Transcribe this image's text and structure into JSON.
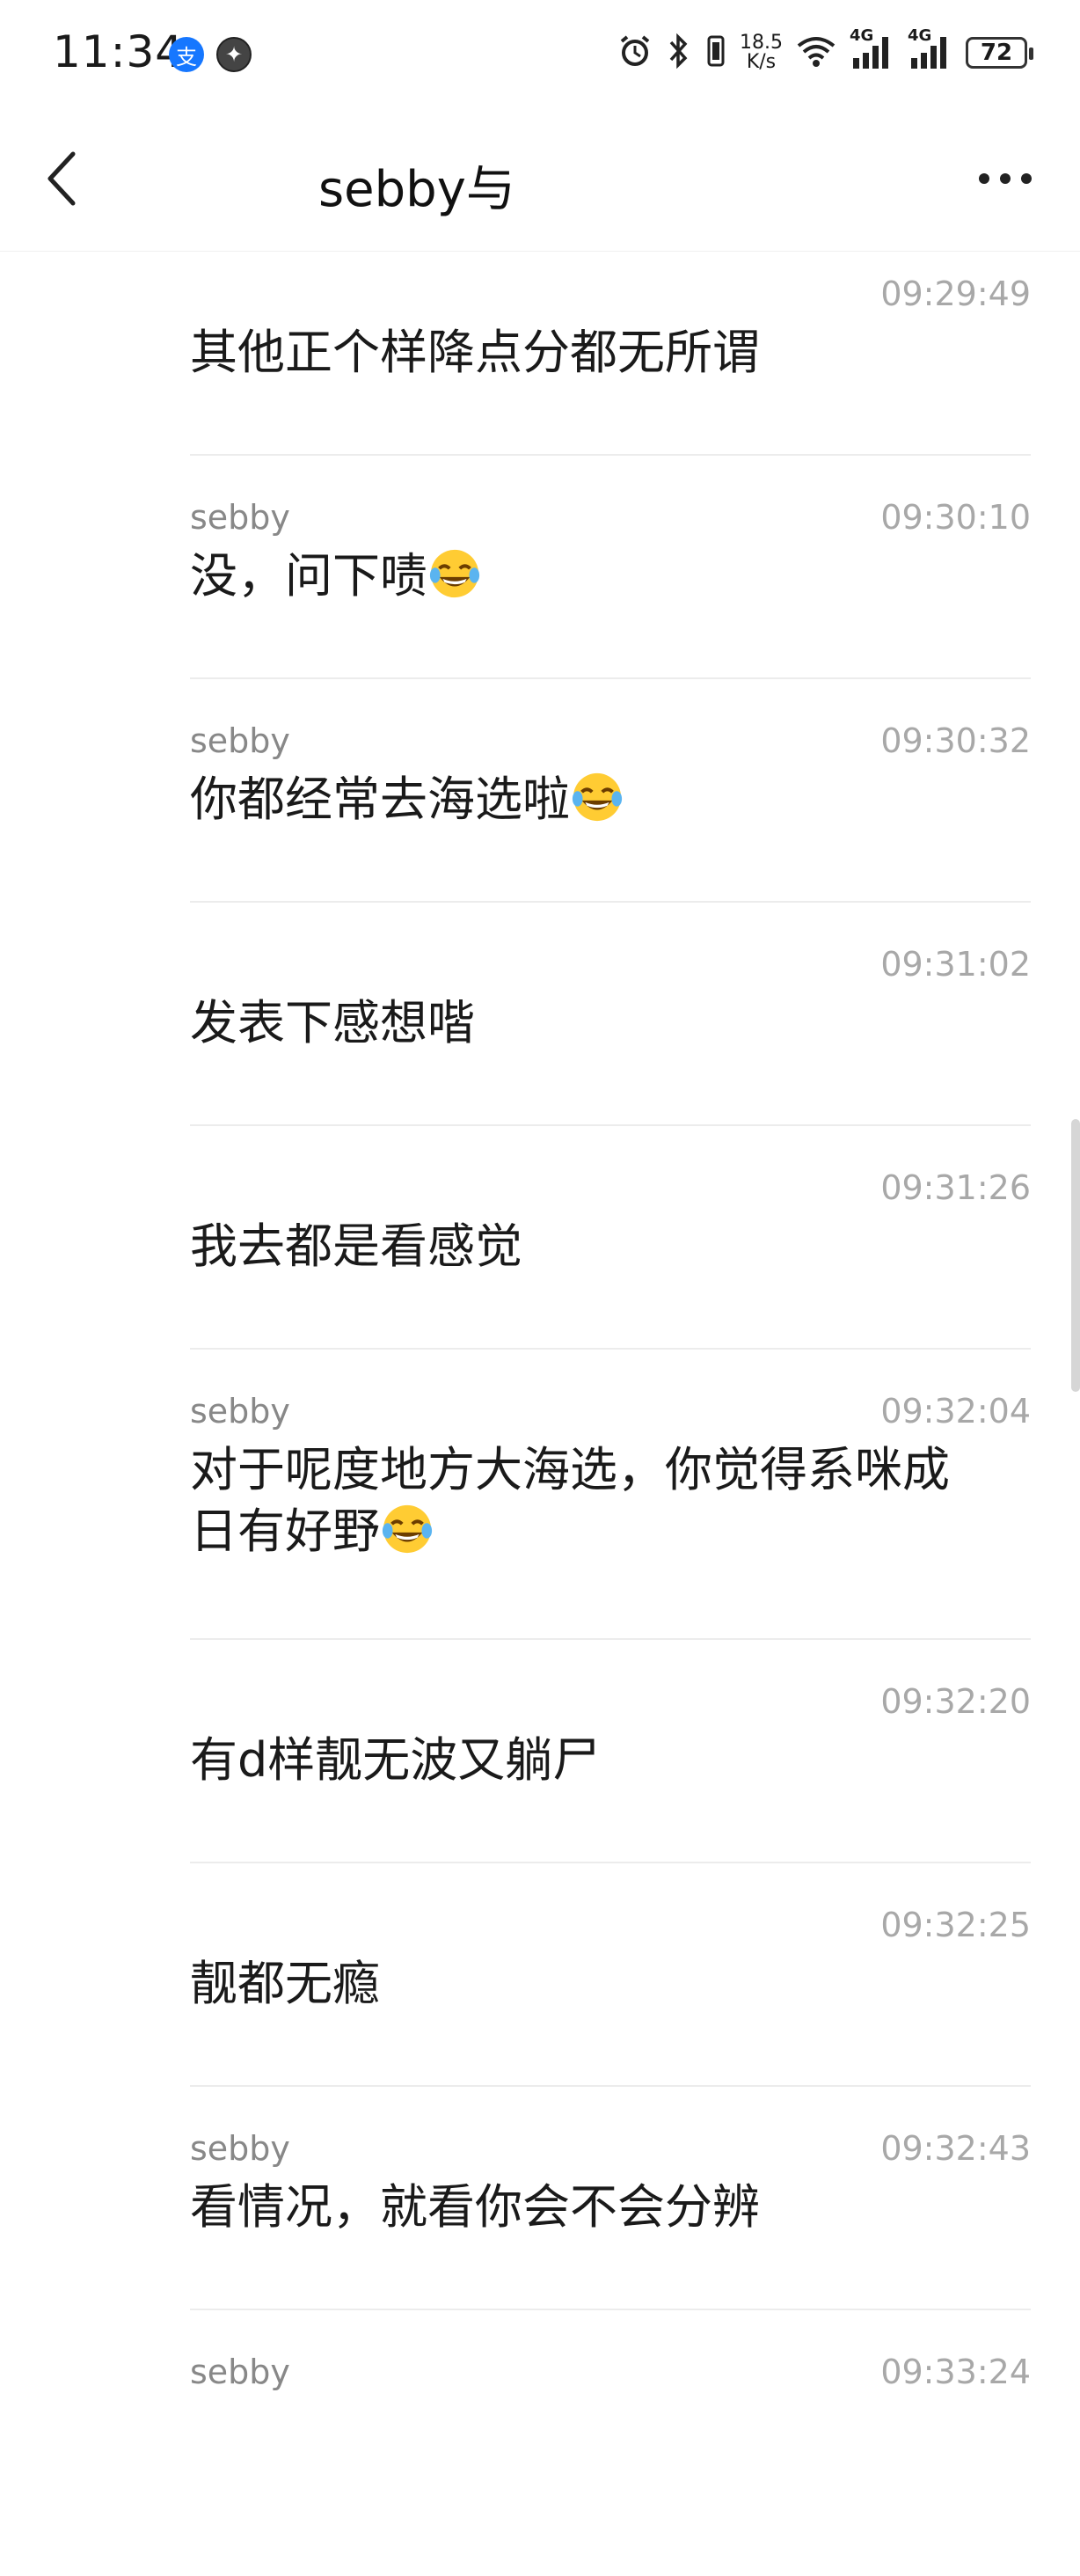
{
  "status_bar": {
    "time": "11:34",
    "net_speed_value": "18.5",
    "net_speed_unit": "K/s",
    "signal_1": "4G",
    "signal_2": "4G",
    "battery": "72"
  },
  "header": {
    "title": "sebby与"
  },
  "messages": [
    {
      "sender": "",
      "time": "09:29:49",
      "text": "其他正个样降点分都无所谓"
    },
    {
      "sender": "sebby",
      "time": "09:30:10",
      "text": "没，问下啧",
      "emoji": "laughing-tears-emoji"
    },
    {
      "sender": "sebby",
      "time": "09:30:32",
      "text": "你都经常去海选啦",
      "emoji": "laughing-tears-emoji"
    },
    {
      "sender": "",
      "time": "09:31:02",
      "text": "发表下感想喈"
    },
    {
      "sender": "",
      "time": "09:31:26",
      "text": "我去都是看感觉"
    },
    {
      "sender": "sebby",
      "time": "09:32:04",
      "text_line1": "对于呢度地方大海选，你觉得系咪成",
      "text_line2": "日有好野",
      "emoji": "laughing-tears-emoji"
    },
    {
      "sender": "",
      "time": "09:32:20",
      "text": "有d样靓无波又躺尸"
    },
    {
      "sender": "",
      "time": "09:32:25",
      "text": "靓都无瘾"
    },
    {
      "sender": "sebby",
      "time": "09:32:43",
      "text": "看情况，就看你会不会分辨"
    },
    {
      "sender": "sebby",
      "time": "09:33:24",
      "text": ""
    }
  ],
  "colors": {
    "text": "#1a1a1a",
    "sender": "#888888",
    "timestamp": "#a8a8a8",
    "divider": "#ececec"
  }
}
